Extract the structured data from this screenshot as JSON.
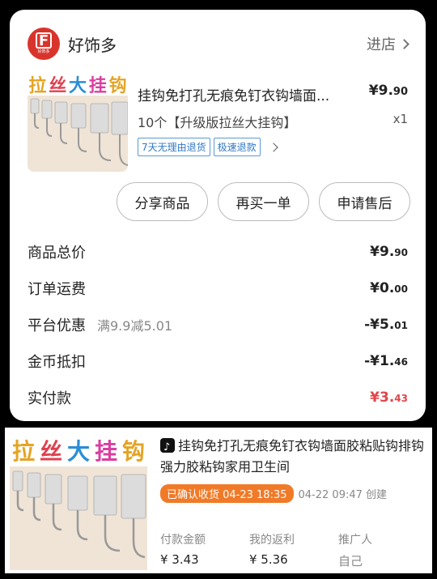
{
  "store": {
    "logo_text": "好饰多",
    "name": "好饰多",
    "enter_label": "进店"
  },
  "product": {
    "banner_chars": [
      "拉",
      "丝",
      "大",
      "挂",
      "钩"
    ],
    "title": "挂钩免打孔无痕免钉衣钩墙面...",
    "price_main": "¥9.",
    "price_cents": "90",
    "spec": "10个【升级版拉丝大挂钩】",
    "qty": "x1",
    "tags": [
      "7天无理由退货",
      "极速退款"
    ]
  },
  "actions": [
    "分享商品",
    "再买一单",
    "申请售后"
  ],
  "summary": [
    {
      "label": "商品总价",
      "note": "",
      "value_main": "¥9.",
      "value_cents": "90",
      "highlight": false
    },
    {
      "label": "订单运费",
      "note": "",
      "value_main": "¥0.",
      "value_cents": "00",
      "highlight": false
    },
    {
      "label": "平台优惠",
      "note": "满9.9减5.01",
      "value_main": "-¥5.",
      "value_cents": "01",
      "highlight": false
    },
    {
      "label": "金币抵扣",
      "note": "",
      "value_main": "-¥1.",
      "value_cents": "46",
      "highlight": false
    },
    {
      "label": "实付款",
      "note": "",
      "value_main": "¥3.",
      "value_cents": "43",
      "highlight": true
    }
  ],
  "order": {
    "title": "挂钩免打孔无痕免钉衣钩墙面胶粘贴钩排钩强力胶粘钩家用卫生间",
    "status": "已确认收货 04-23 18:35",
    "created": "04-22 09:47 创建",
    "stats": [
      {
        "key": "付款金额",
        "value": "¥ 3.43"
      },
      {
        "key": "我的返利",
        "value": "¥ 5.36"
      },
      {
        "key": "推广人",
        "value": "自己"
      }
    ]
  },
  "colors": {
    "accent_red": "#e0454a",
    "brand_red": "#d9342b",
    "tag_blue": "#2f78c7",
    "status_orange": "#f07a28"
  }
}
